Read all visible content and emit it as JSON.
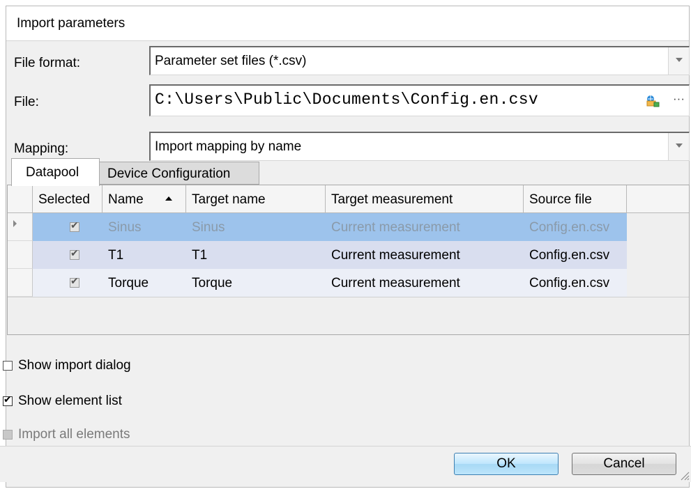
{
  "dialog": {
    "title": "Import parameters"
  },
  "form": {
    "file_format_label": "File format:",
    "file_format_value": "Parameter set files (*.csv)",
    "file_label": "File:",
    "file_value": "C:\\Users\\Public\\Documents\\Config.en.csv",
    "browse_label": "···",
    "mapping_label": "Mapping:",
    "mapping_value": "Import mapping by name"
  },
  "tabs": [
    {
      "label": "Datapool",
      "active": true
    },
    {
      "label": "Device Configuration",
      "active": false
    }
  ],
  "grid": {
    "columns": [
      "Selected",
      "Name",
      "Target name",
      "Target measurement",
      "Source file"
    ],
    "sort_column": "Name",
    "sort_direction": "ascending",
    "rows": [
      {
        "selected": true,
        "name": "Sinus",
        "target_name": "Sinus",
        "target_measurement": "Current measurement",
        "source_file": "Config.en.csv",
        "current": true
      },
      {
        "selected": true,
        "name": "T1",
        "target_name": "T1",
        "target_measurement": "Current measurement",
        "source_file": "Config.en.csv",
        "current": false
      },
      {
        "selected": true,
        "name": "Torque",
        "target_name": "Torque",
        "target_measurement": "Current measurement",
        "source_file": "Config.en.csv",
        "current": false
      }
    ]
  },
  "options": {
    "show_import_dialog": {
      "label": "Show import dialog",
      "checked": false
    },
    "show_element_list": {
      "label": "Show element list",
      "checked": true
    },
    "import_all_elements": {
      "label": "Import all elements",
      "checked": false,
      "disabled": true
    }
  },
  "buttons": {
    "ok": "OK",
    "cancel": "Cancel"
  },
  "icons": {
    "file_picker": "folder-network-icon",
    "sort": "sort-ascending-icon",
    "row_indicator": "row-pointer-icon",
    "resize": "resize-grip-icon"
  },
  "colors": {
    "selected_row": "#9dc3ec",
    "alt_row": "#d9deef",
    "normal_row": "#eceff7",
    "primary_button": "#bee6fd"
  }
}
